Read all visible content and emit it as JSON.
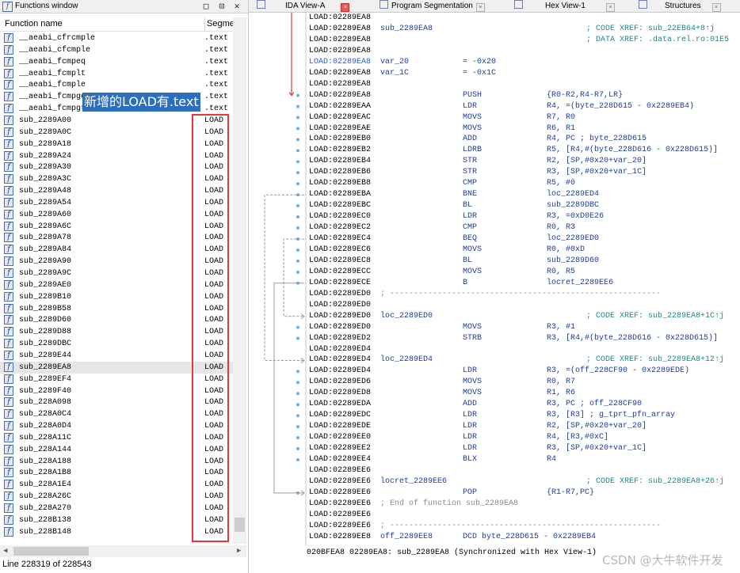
{
  "functions_window": {
    "title": "Functions window",
    "title_buttons": [
      "□",
      "⊡",
      "✕"
    ],
    "columns": [
      "Function name",
      "Segme"
    ],
    "rows": [
      {
        "name": "__aeabi_cfrcmple",
        "seg": ".text"
      },
      {
        "name": "__aeabi_cfcmple",
        "seg": ".text"
      },
      {
        "name": "__aeabi_fcmpeq",
        "seg": ".text"
      },
      {
        "name": "__aeabi_fcmplt",
        "seg": ".text"
      },
      {
        "name": "__aeabi_fcmple",
        "seg": ".text"
      },
      {
        "name": "__aeabi_fcmpge",
        "seg": ".text"
      },
      {
        "name": "__aeabi_fcmpgt",
        "seg": ".text"
      },
      {
        "name": "sub_2289A00",
        "seg": "LOAD"
      },
      {
        "name": "sub_2289A0C",
        "seg": "LOAD"
      },
      {
        "name": "sub_2289A18",
        "seg": "LOAD"
      },
      {
        "name": "sub_2289A24",
        "seg": "LOAD"
      },
      {
        "name": "sub_2289A30",
        "seg": "LOAD"
      },
      {
        "name": "sub_2289A3C",
        "seg": "LOAD"
      },
      {
        "name": "sub_2289A48",
        "seg": "LOAD"
      },
      {
        "name": "sub_2289A54",
        "seg": "LOAD"
      },
      {
        "name": "sub_2289A60",
        "seg": "LOAD"
      },
      {
        "name": "sub_2289A6C",
        "seg": "LOAD"
      },
      {
        "name": "sub_2289A78",
        "seg": "LOAD"
      },
      {
        "name": "sub_2289A84",
        "seg": "LOAD"
      },
      {
        "name": "sub_2289A90",
        "seg": "LOAD"
      },
      {
        "name": "sub_2289A9C",
        "seg": "LOAD"
      },
      {
        "name": "sub_2289AE0",
        "seg": "LOAD"
      },
      {
        "name": "sub_2289B10",
        "seg": "LOAD"
      },
      {
        "name": "sub_2289B58",
        "seg": "LOAD"
      },
      {
        "name": "sub_2289D60",
        "seg": "LOAD"
      },
      {
        "name": "sub_2289D88",
        "seg": "LOAD"
      },
      {
        "name": "sub_2289DBC",
        "seg": "LOAD"
      },
      {
        "name": "sub_2289E44",
        "seg": "LOAD"
      },
      {
        "name": "sub_2289EA8",
        "seg": "LOAD",
        "selected": true
      },
      {
        "name": "sub_2289EF4",
        "seg": "LOAD"
      },
      {
        "name": "sub_2289F40",
        "seg": "LOAD"
      },
      {
        "name": "sub_228A098",
        "seg": "LOAD"
      },
      {
        "name": "sub_228A0C4",
        "seg": "LOAD"
      },
      {
        "name": "sub_228A0D4",
        "seg": "LOAD"
      },
      {
        "name": "sub_228A11C",
        "seg": "LOAD"
      },
      {
        "name": "sub_228A144",
        "seg": "LOAD"
      },
      {
        "name": "sub_228A188",
        "seg": "LOAD"
      },
      {
        "name": "sub_228A1B8",
        "seg": "LOAD"
      },
      {
        "name": "sub_228A1E4",
        "seg": "LOAD"
      },
      {
        "name": "sub_228A26C",
        "seg": "LOAD"
      },
      {
        "name": "sub_228A270",
        "seg": "LOAD"
      },
      {
        "name": "sub_228B138",
        "seg": "LOAD"
      },
      {
        "name": "sub_228B148",
        "seg": "LOAD"
      }
    ],
    "status": "Line 228319 of 228543",
    "callout": "新增的LOAD有.text"
  },
  "tabs": [
    {
      "label": "IDA View-A",
      "active": true
    },
    {
      "label": "Program Segmentation"
    },
    {
      "label": "Hex View-1"
    },
    {
      "label": "Structures"
    }
  ],
  "disasm": [
    {
      "addr": "LOAD:02289EA8"
    },
    {
      "addr": "LOAD:02289EA8",
      "label": "sub_2289EA8",
      "comment": "; CODE XREF: sub_22EB64+8↑j"
    },
    {
      "addr": "LOAD:02289EA8",
      "comment": "; DATA XREF: .data.rel.ro:01E5"
    },
    {
      "addr": "LOAD:02289EA8"
    },
    {
      "addr": "LOAD:02289EA8",
      "label": "var_20",
      "mn": "= -0x20",
      "hl": true
    },
    {
      "addr": "LOAD:02289EA8",
      "label": "var_1C",
      "mn": "= -0x1C"
    },
    {
      "addr": "LOAD:02289EA8"
    },
    {
      "addr": "LOAD:02289EA8",
      "mn": "PUSH",
      "op": "{R0-R2,R4-R7,LR}"
    },
    {
      "addr": "LOAD:02289EAA",
      "mn": "LDR",
      "op": "R4, =(byte_228D615 - 0x2289EB4)"
    },
    {
      "addr": "LOAD:02289EAC",
      "mn": "MOVS",
      "op": "R7, R0"
    },
    {
      "addr": "LOAD:02289EAE",
      "mn": "MOVS",
      "op": "R6, R1"
    },
    {
      "addr": "LOAD:02289EB0",
      "mn": "ADD",
      "op": "R4, PC ; byte_228D615"
    },
    {
      "addr": "LOAD:02289EB2",
      "mn": "LDRB",
      "op": "R5, [R4,#(byte_228D616 - 0x228D615)]"
    },
    {
      "addr": "LOAD:02289EB4",
      "mn": "STR",
      "op": "R2, [SP,#0x20+var_20]"
    },
    {
      "addr": "LOAD:02289EB6",
      "mn": "STR",
      "op": "R3, [SP,#0x20+var_1C]"
    },
    {
      "addr": "LOAD:02289EB8",
      "mn": "CMP",
      "op": "R5, #0"
    },
    {
      "addr": "LOAD:02289EBA",
      "mn": "BNE",
      "op": "loc_2289ED4"
    },
    {
      "addr": "LOAD:02289EBC",
      "mn": "BL",
      "op": "sub_2289DBC"
    },
    {
      "addr": "LOAD:02289EC0",
      "mn": "LDR",
      "op": "R3, =0xD0E26"
    },
    {
      "addr": "LOAD:02289EC2",
      "mn": "CMP",
      "op": "R0, R3"
    },
    {
      "addr": "LOAD:02289EC4",
      "mn": "BEQ",
      "op": "loc_2289ED0"
    },
    {
      "addr": "LOAD:02289EC6",
      "mn": "MOVS",
      "op": "R0, #0xD"
    },
    {
      "addr": "LOAD:02289EC8",
      "mn": "BL",
      "op": "sub_2289D60"
    },
    {
      "addr": "LOAD:02289ECC",
      "mn": "MOVS",
      "op": "R0, R5"
    },
    {
      "addr": "LOAD:02289ECE",
      "mn": "B",
      "op": "locret_2289EE6"
    },
    {
      "addr": "LOAD:02289ED0",
      "sep": "; ---------------------------------------------------------"
    },
    {
      "addr": "LOAD:02289ED0"
    },
    {
      "addr": "LOAD:02289ED0",
      "label": "loc_2289ED0",
      "comment": "; CODE XREF: sub_2289EA8+1C↑j"
    },
    {
      "addr": "LOAD:02289ED0",
      "mn": "MOVS",
      "op": "R3, #1"
    },
    {
      "addr": "LOAD:02289ED2",
      "mn": "STRB",
      "op": "R3, [R4,#(byte_228D616 - 0x228D615)]"
    },
    {
      "addr": "LOAD:02289ED4"
    },
    {
      "addr": "LOAD:02289ED4",
      "label": "loc_2289ED4",
      "comment": "; CODE XREF: sub_2289EA8+12↑j"
    },
    {
      "addr": "LOAD:02289ED4",
      "mn": "LDR",
      "op": "R3, =(off_228CF90 - 0x2289EDE)"
    },
    {
      "addr": "LOAD:02289ED6",
      "mn": "MOVS",
      "op": "R0, R7"
    },
    {
      "addr": "LOAD:02289ED8",
      "mn": "MOVS",
      "op": "R1, R6"
    },
    {
      "addr": "LOAD:02289EDA",
      "mn": "ADD",
      "op": "R3, PC ; off_228CF90"
    },
    {
      "addr": "LOAD:02289EDC",
      "mn": "LDR",
      "op": "R3, [R3] ; g_tprt_pfn_array"
    },
    {
      "addr": "LOAD:02289EDE",
      "mn": "LDR",
      "op": "R2, [SP,#0x20+var_20]"
    },
    {
      "addr": "LOAD:02289EE0",
      "mn": "LDR",
      "op": "R4, [R3,#0xC]"
    },
    {
      "addr": "LOAD:02289EE2",
      "mn": "LDR",
      "op": "R3, [SP,#0x20+var_1C]"
    },
    {
      "addr": "LOAD:02289EE4",
      "mn": "BLX",
      "op": "R4"
    },
    {
      "addr": "LOAD:02289EE6"
    },
    {
      "addr": "LOAD:02289EE6",
      "label": "locret_2289EE6",
      "comment": "; CODE XREF: sub_2289EA8+26↑j"
    },
    {
      "addr": "LOAD:02289EE6",
      "mn": "POP",
      "op": "{R1-R7,PC}"
    },
    {
      "addr": "LOAD:02289EE6",
      "sep": "; End of function sub_2289EA8"
    },
    {
      "addr": "LOAD:02289EE6"
    },
    {
      "addr": "LOAD:02289EE6",
      "sep": "; ---------------------------------------------------------"
    },
    {
      "addr": "LOAD:02289EE8",
      "label": "off_2289EE8",
      "mn": "DCD byte_228D615 - 0x2289EB4"
    }
  ],
  "ida_status": "020BFEA8 02289EA8: sub_2289EA8 (Synchronized with Hex View-1)",
  "watermark": "CSDN @大牛软件开发"
}
